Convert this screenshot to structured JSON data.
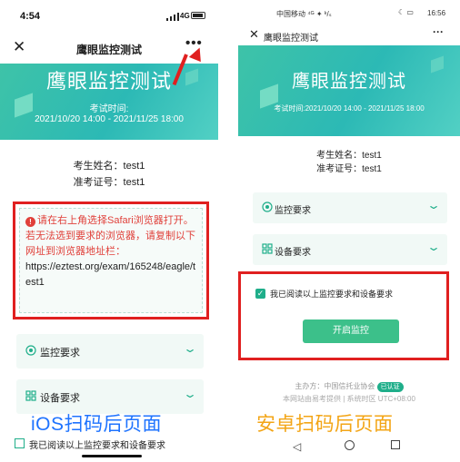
{
  "ios": {
    "status_time": "4:54",
    "status_network": "4G",
    "nav": {
      "title": "鹰眼监控测试",
      "close": "✕",
      "more": "•••"
    },
    "banner": {
      "title": "鹰眼监控测试",
      "time_label": "考试时间:",
      "time_range": "2021/10/20 14:00 - 2021/11/25 18:00"
    },
    "info": {
      "name": "考生姓名：test1",
      "ticket": "准考证号：test1"
    },
    "warning": {
      "line1": "请在右上角选择Safari浏览器打开。",
      "line2": "若无法选到要求的浏览器，请复制以下网址到浏览器地址栏：",
      "url": "https://eztest.org/exam/165248/eagle/test1"
    },
    "accordions": [
      {
        "label": "监控要求",
        "icon": "eye-icon"
      },
      {
        "label": "设备要求",
        "icon": "device-icon"
      }
    ],
    "agree_label": "我已阅读以上监控要求和设备要求",
    "caption": "iOS扫码后页面"
  },
  "android": {
    "status_carrier": "中国移动",
    "status_icons": "⁴ᴳ ✦ ᵏ/ₛ",
    "status_right_icons": "☾ ▭",
    "status_time": "16:56",
    "nav": {
      "title": "鹰眼监控测试",
      "close": "✕",
      "more": "···"
    },
    "banner": {
      "title": "鹰眼监控测试",
      "time_range": "考试时间:2021/10/20 14:00 - 2021/11/25 18:00"
    },
    "info": {
      "name": "考生姓名：test1",
      "ticket": "准考证号：test1"
    },
    "accordions": [
      {
        "label": "监控要求",
        "icon": "eye-icon"
      },
      {
        "label": "设备要求",
        "icon": "device-icon"
      }
    ],
    "agree_label": "我已阅读以上监控要求和设备要求",
    "start_button": "开启监控",
    "footer": {
      "organizer": "主办方：中国信托业协会",
      "verified": "已认证",
      "provider": "本网站由易考提供 | 系统时区 UTC+08:00"
    },
    "caption": "安卓扫码后页面"
  },
  "colors": {
    "accent_green": "#1fae8a",
    "banner_teal": "#2cb9b5",
    "highlight_red": "#e02020",
    "ios_caption_blue": "#1e73ff",
    "android_caption_orange": "#f3a516"
  }
}
